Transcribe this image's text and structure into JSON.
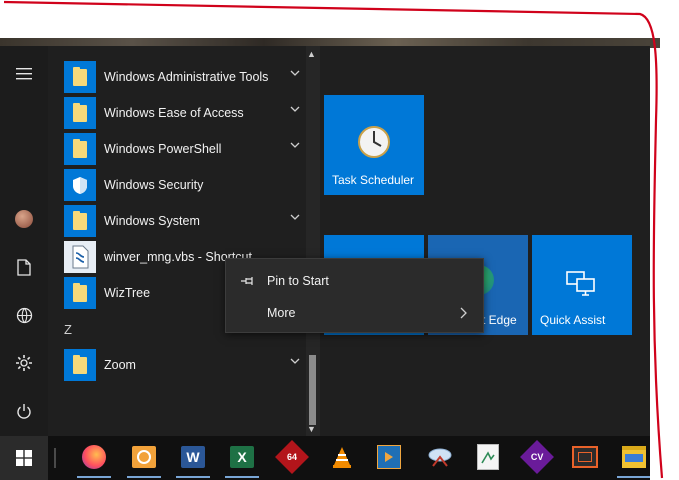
{
  "app_list": {
    "items": [
      {
        "label": "Windows Administrative Tools",
        "icon": "folder-icon",
        "expandable": true
      },
      {
        "label": "Windows Ease of Access",
        "icon": "folder-icon",
        "expandable": true
      },
      {
        "label": "Windows PowerShell",
        "icon": "folder-icon",
        "expandable": true
      },
      {
        "label": "Windows Security",
        "icon": "shield-icon",
        "expandable": false
      },
      {
        "label": "Windows System",
        "icon": "folder-icon",
        "expandable": true
      },
      {
        "label": "winver_mng.vbs - Shortcut",
        "icon": "script-file-icon",
        "expandable": false
      },
      {
        "label": "WizTree",
        "icon": "folder-icon",
        "expandable": false
      }
    ],
    "group_header": "Z",
    "z_items": [
      {
        "label": "Zoom",
        "icon": "folder-icon",
        "expandable": true
      }
    ]
  },
  "tiles": [
    {
      "label": "Task Scheduler",
      "icon": "clock-icon"
    },
    {
      "label": "",
      "icon": "none"
    },
    {
      "label": "t Edge",
      "icon": "edge-icon"
    },
    {
      "label": "Quick Assist",
      "icon": "monitors-icon"
    }
  ],
  "context_menu": {
    "pin_label": "Pin to Start",
    "more_label": "More"
  },
  "rail": {
    "icons": [
      "hamburger-icon",
      "user-avatar",
      "document-icon",
      "pictures-icon",
      "settings-icon",
      "power-icon"
    ]
  },
  "taskbar": {
    "apps": [
      "firefox-icon",
      "outlook-icon",
      "word-icon",
      "excel-icon",
      "app-64-icon",
      "vlc-icon",
      "media-player-icon",
      "snipping-icon",
      "notepad-icon",
      "cv-icon",
      "presentation-icon",
      "file-explorer-icon"
    ],
    "badge_64": "64",
    "badge_cv": "CV"
  },
  "colors": {
    "accent": "#0078d7",
    "menu_bg": "#1f1f1f",
    "annotation": "#d0021b"
  }
}
